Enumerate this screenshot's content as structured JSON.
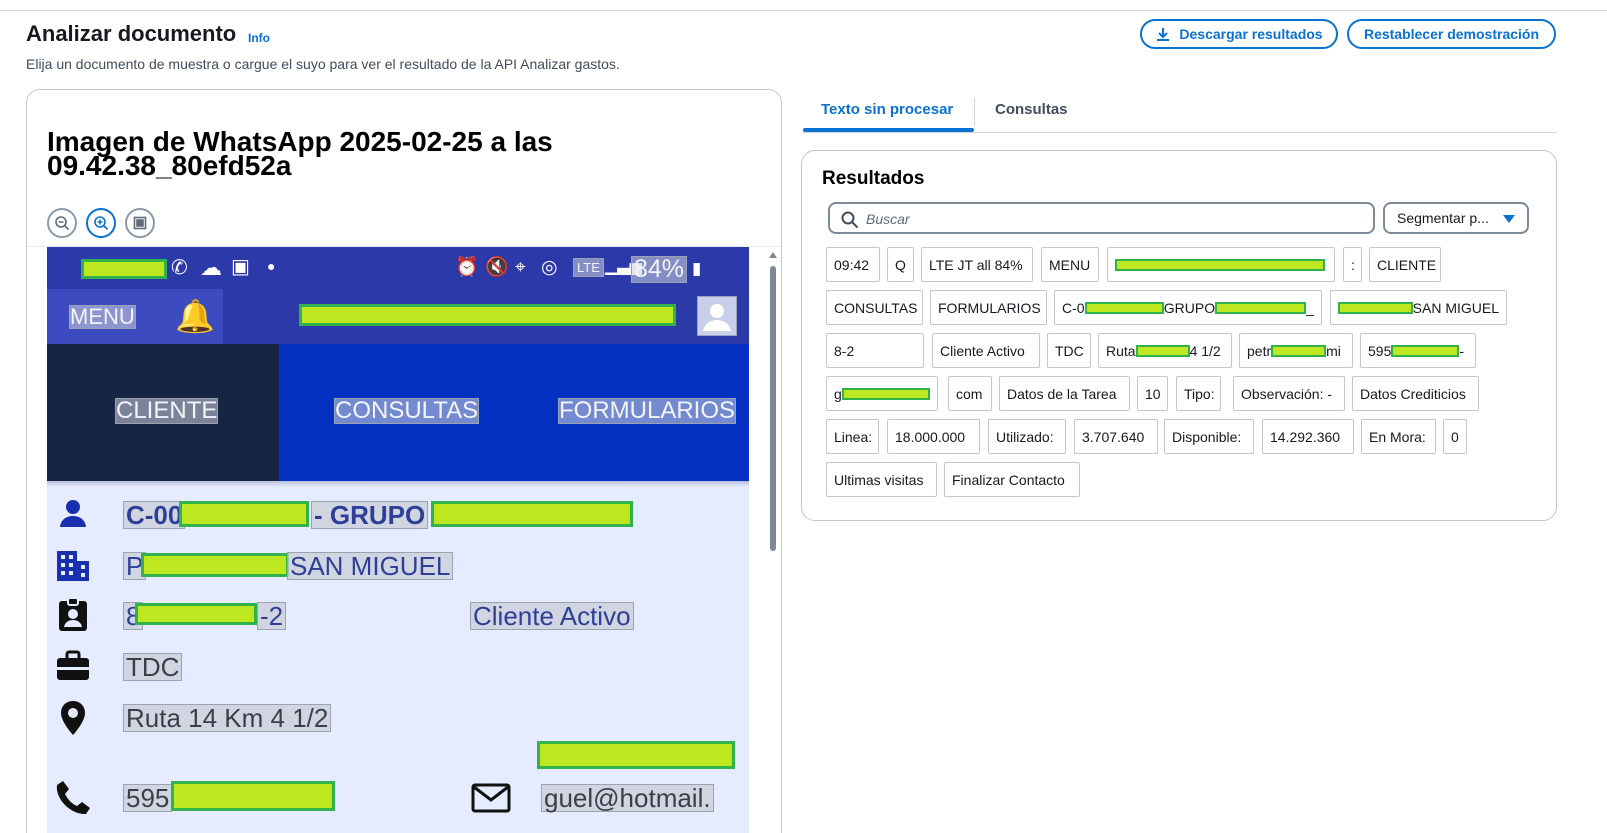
{
  "header": {
    "title": "Analizar documento",
    "info": "Info",
    "subtitle": "Elija un documento de muestra o cargue el suyo para ver el resultado de la API Analizar gastos.",
    "download_label": "Descargar resultados",
    "reset_label": "Restablecer demostración"
  },
  "document": {
    "title": "Imagen de WhatsApp 2025-02-25 a las 09.42.38_80efd52a",
    "phone": {
      "battery": "84%",
      "network": "LTE",
      "menu": "MENU",
      "nav": [
        "CLIENTE",
        "CONSULTAS",
        "FORMULARIOS"
      ],
      "client_code": "C-00",
      "group": "- GRUPO",
      "location_prefix": "P",
      "location_suffix": "SAN MIGUEL",
      "id_prefix": "8",
      "id_suffix": "-2",
      "status": "Cliente Activo",
      "product": "TDC",
      "address": "Ruta 14 Km 4 1/2",
      "phone_prefix": "595",
      "email_suffix": "guel@hotmail."
    }
  },
  "tabs": {
    "raw": "Texto sin procesar",
    "queries": "Consultas"
  },
  "results": {
    "title": "Resultados",
    "search_placeholder": "Buscar",
    "segment_label": "Segmentar p...",
    "chips": [
      {
        "text": "09:42"
      },
      {
        "text": "Q"
      },
      {
        "text": "LTE JT all 84%"
      },
      {
        "text": "MENU"
      },
      {
        "text": ""
      },
      {
        "text": ":"
      },
      {
        "text": "CLIENTE"
      },
      {
        "text": "CONSULTAS"
      },
      {
        "text": "FORMULARIOS"
      },
      {
        "text": "C-0",
        "after": "GRUPO",
        "tail": "_"
      },
      {
        "text": "",
        "after": "SAN MIGUEL"
      },
      {
        "text": "8",
        "after": "-2"
      },
      {
        "text": "Cliente Activo"
      },
      {
        "text": "TDC"
      },
      {
        "text": "Ruta",
        "after": "4 1/2"
      },
      {
        "text": "petr",
        "after": "mi"
      },
      {
        "text": "595",
        "after": "-"
      },
      {
        "text": "g"
      },
      {
        "text": "com"
      },
      {
        "text": "Datos de la Tarea"
      },
      {
        "text": "10"
      },
      {
        "text": "Tipo:"
      },
      {
        "text": "Observación: -"
      },
      {
        "text": "Datos Crediticios"
      },
      {
        "text": "Linea:"
      },
      {
        "text": "18.000.000"
      },
      {
        "text": "Utilizado:"
      },
      {
        "text": "3.707.640"
      },
      {
        "text": "Disponible:"
      },
      {
        "text": "14.292.360"
      },
      {
        "text": "En Mora:"
      },
      {
        "text": "0"
      },
      {
        "text": "Ultimas visitas"
      },
      {
        "text": "Finalizar Contacto"
      }
    ]
  },
  "colors": {
    "accent": "#0972d3",
    "redaction_fill": "#bde820",
    "redaction_border": "#2fb34a",
    "phone_header": "#2c3aa8",
    "phone_nav": "#0531c2",
    "phone_nav_active": "#152543"
  }
}
